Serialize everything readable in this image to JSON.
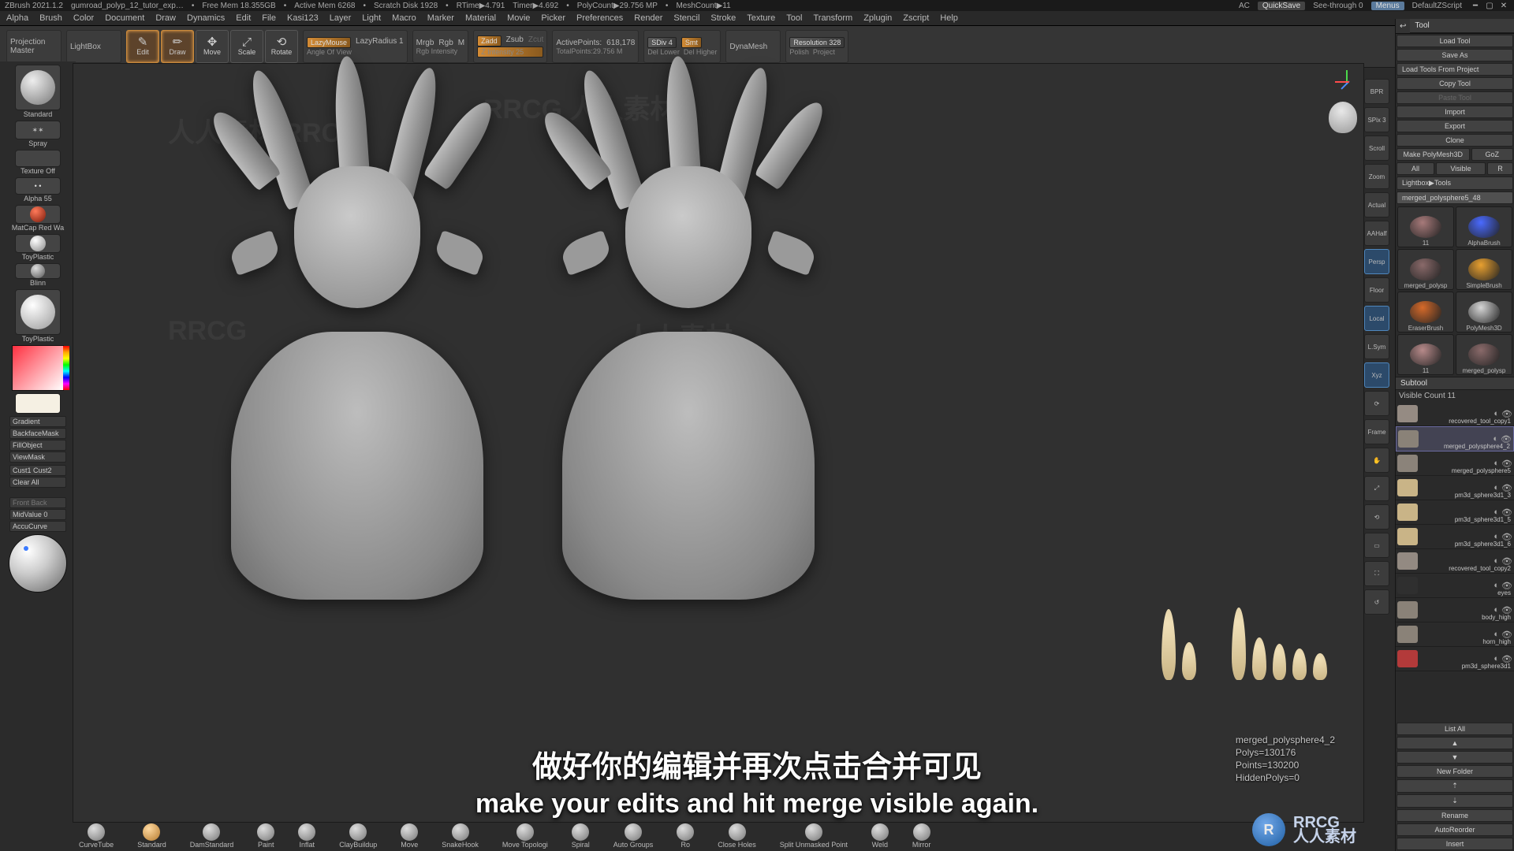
{
  "title_bar": {
    "app": "ZBrush 2021.1.2",
    "document": "gumroad_polyp_12_tutor_exp…",
    "free_mem": "Free Mem 18.355GB",
    "active_mem": "Active Mem 6268",
    "scratch": "Scratch Disk 1928",
    "rtime": "RTime▶4.791",
    "timer": "Timer▶4.692",
    "polycount": "PolyCount▶29.756 MP",
    "meshcount": "MeshCount▶11",
    "ac": "AC",
    "quicksave": "QuickSave",
    "seethrough": "See-through  0",
    "menus": "Menus",
    "zscript": "DefaultZScript"
  },
  "menu": [
    "Alpha",
    "Brush",
    "Color",
    "Document",
    "Draw",
    "Dynamics",
    "Edit",
    "File",
    "Kasi123",
    "Layer",
    "Light",
    "Macro",
    "Marker",
    "Material",
    "Movie",
    "Picker",
    "Preferences",
    "Render",
    "Stencil",
    "Stroke",
    "Texture",
    "Tool",
    "Transform",
    "Zplugin",
    "Zscript",
    "Help"
  ],
  "opt": {
    "projection": "Projection\nMaster",
    "lightbox": "LightBox",
    "modes": [
      {
        "name": "Edit",
        "active": true,
        "icon": "✎"
      },
      {
        "name": "Draw",
        "active": true,
        "icon": "✏"
      },
      {
        "name": "Move",
        "active": false,
        "icon": "✥"
      },
      {
        "name": "Scale",
        "active": false,
        "icon": "⤢"
      },
      {
        "name": "Rotate",
        "active": false,
        "icon": "⟲"
      }
    ],
    "lazy": {
      "mouse": "LazyMouse",
      "radius": "LazyRadius 1",
      "angle": "Angle Of View"
    },
    "rgb": {
      "mrgb": "Mrgb",
      "rgb": "Rgb",
      "m": "M",
      "intensity": "Rgb Intensity"
    },
    "z": {
      "zadd": "Zadd",
      "zsub": "Zsub",
      "zcut": "Zcut",
      "intensity": "Z Intensity 25"
    },
    "pts": {
      "active_lbl": "ActivePoints:",
      "active_val": "618,178",
      "total_lbl": "TotalPoints:",
      "total_val": "29.756 M"
    },
    "sdiv": {
      "lbl": "SDiv 4",
      "lower": "Del Lower",
      "higher": "Del Higher",
      "smt": "Smt"
    },
    "dyn": "DynaMesh",
    "res": {
      "lbl": "Resolution 328",
      "polish": "Polish",
      "project": "Project"
    }
  },
  "left": {
    "brush": "Standard",
    "stroke": "Spray",
    "texture": "Texture Off",
    "alpha": "Alpha 55",
    "mat1": "MatCap Red Wa",
    "mat2": "ToyPlastic",
    "mat3": "Blinn",
    "mat4": "ToyPlastic",
    "btns": [
      "Gradient",
      "BackfaceMask",
      "FillObject",
      "ViewMask"
    ],
    "cust": "Cust1   Cust2",
    "clear": "Clear All",
    "front_back": "Front   Back",
    "midvalue": "MidValue 0",
    "accu": "AccuCurve"
  },
  "canvas_icons": [
    {
      "lbl": "BPR",
      "on": false
    },
    {
      "lbl": "SPix 3",
      "on": false
    },
    {
      "lbl": "Scroll",
      "on": false
    },
    {
      "lbl": "Zoom",
      "on": false
    },
    {
      "lbl": "Actual",
      "on": false
    },
    {
      "lbl": "AAHalf",
      "on": false
    },
    {
      "lbl": "Persp",
      "on": true
    },
    {
      "lbl": "Floor",
      "on": false
    },
    {
      "lbl": "Local",
      "on": true
    },
    {
      "lbl": "L.Sym",
      "on": false
    },
    {
      "lbl": "Xyz",
      "on": true
    },
    {
      "lbl": "⟳",
      "on": false
    },
    {
      "lbl": "Frame",
      "on": false
    },
    {
      "lbl": "✋",
      "on": false
    },
    {
      "lbl": "⤢",
      "on": false
    },
    {
      "lbl": "⟲",
      "on": false
    },
    {
      "lbl": "▭",
      "on": false
    },
    {
      "lbl": "⛶",
      "on": false
    },
    {
      "lbl": "↺",
      "on": false
    }
  ],
  "tool_panel": {
    "header": "Tool",
    "row1": [
      "Load Tool",
      "Save As"
    ],
    "row2": "Load Tools From Project",
    "row3": [
      "Copy Tool",
      "Paste Tool"
    ],
    "row4": [
      "Import",
      "Export"
    ],
    "row5": [
      "Clone",
      "Make PolyMesh3D"
    ],
    "row6": [
      "GoZ",
      "All",
      "Visible",
      "R"
    ],
    "lightbox": "Lightbox▶Tools",
    "current": "merged_polysphere5_48",
    "thumbs": [
      {
        "name": "11",
        "color": "#a77a7a"
      },
      {
        "name": "AlphaBrush",
        "color": "#4a6aff"
      },
      {
        "name": "merged_polysp",
        "color": "#8a6a6a"
      },
      {
        "name": "SimpleBrush",
        "color": "#e8a030"
      },
      {
        "name": "EraserBrush",
        "color": "#d56a2a"
      },
      {
        "name": "PolyMesh3D",
        "color": "#d6d6d6"
      },
      {
        "name": "11",
        "color": "#b78a8a"
      },
      {
        "name": "merged_polysp",
        "color": "#8a6a6a"
      }
    ]
  },
  "subtool": {
    "header": "Subtool",
    "count": "Visible Count 11",
    "items": [
      {
        "name": "recovered_tool_copy1",
        "sel": false,
        "color": "#958b83"
      },
      {
        "name": "merged_polysphere4_2",
        "sel": true,
        "color": "#8a8278"
      },
      {
        "name": "merged_polysphere5",
        "sel": false,
        "color": "#8b837a"
      },
      {
        "name": "pm3d_sphere3d1_3",
        "sel": false,
        "color": "#c9b487"
      },
      {
        "name": "pm3d_sphere3d1_5",
        "sel": false,
        "color": "#c9b487"
      },
      {
        "name": "pm3d_sphere3d1_6",
        "sel": false,
        "color": "#c9b487"
      },
      {
        "name": "recovered_tool_copy2",
        "sel": false,
        "color": "#938a82"
      },
      {
        "name": "eyes",
        "sel": false,
        "color": "#2f2f2f"
      },
      {
        "name": "body_high",
        "sel": false,
        "color": "#8a8278"
      },
      {
        "name": "horn_high",
        "sel": false,
        "color": "#8a8278"
      },
      {
        "name": "pm3d_sphere3d1",
        "sel": false,
        "color": "#b33a3a"
      }
    ],
    "list_all": "List All",
    "new_folder": "New Folder",
    "rename": "Rename",
    "autoreorder": "AutoReorder",
    "insert": "Insert"
  },
  "info": {
    "l1": "merged_polysphere4_2",
    "l2": "Polys=130176",
    "l3": "Points=130200",
    "l4": "HiddenPolys=0"
  },
  "bottom_shelf": [
    "CurveTube",
    "Standard",
    "DamStandard",
    "Paint",
    "Inflat",
    "ClayBuildup",
    "Move",
    "SnakeHook",
    "Move Topologi",
    "Spiral",
    "Auto Groups",
    "Ro",
    "Close Holes",
    "Split Unmasked Point",
    "Weld",
    "Mirror"
  ],
  "subtitle": {
    "cn": "做好你的编辑并再次点击合并可见",
    "en": "make your edits and hit merge visible again."
  },
  "brand": {
    "logo": "R",
    "text": "RRCG\n人人素材"
  }
}
